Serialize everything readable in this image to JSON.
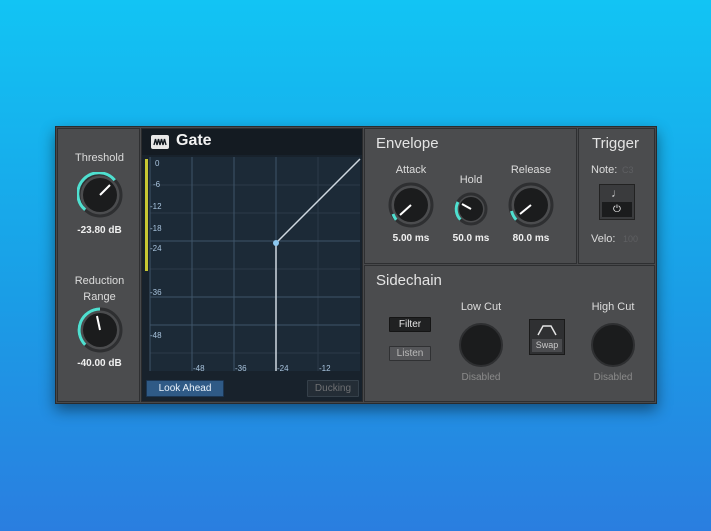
{
  "threshold": {
    "label": "Threshold",
    "value": "-23.80 dB",
    "level": 0.8
  },
  "reduction": {
    "label_line1": "Reduction",
    "label_line2": "Range",
    "value": "-40.00 dB",
    "level": 0.45
  },
  "graph": {
    "title": "Gate",
    "y_ticks": [
      "0",
      "-6",
      "-12",
      "-18",
      "-24",
      "-36",
      "-48"
    ],
    "x_ticks": [
      "-48",
      "-36",
      "-24",
      "-12"
    ],
    "look_ahead_label": "Look Ahead",
    "ducking_label": "Ducking"
  },
  "envelope": {
    "title": "Envelope",
    "attack": {
      "label": "Attack",
      "value": "5.00 ms",
      "level": 0.1
    },
    "hold": {
      "label": "Hold",
      "value": "50.0 ms",
      "level": 0.2
    },
    "release": {
      "label": "Release",
      "value": "80.0 ms",
      "level": 0.15
    }
  },
  "trigger": {
    "title": "Trigger",
    "note_label": "Note:",
    "note_value": "C3",
    "velo_label": "Velo:",
    "velo_value": "100",
    "note_icon": "music-note-icon",
    "power_icon": "power-icon"
  },
  "sidechain": {
    "title": "Sidechain",
    "filter_label": "Filter",
    "listen_label": "Listen",
    "low_cut": {
      "label": "Low Cut",
      "status": "Disabled"
    },
    "high_cut": {
      "label": "High Cut",
      "status": "Disabled"
    },
    "swap_label": "Swap",
    "swap_icon": "bandpass-icon"
  },
  "colors": {
    "accent": "#4fe0d0",
    "graph_bg": "#1c2a37",
    "graph_line": "#cfd8e0",
    "look_ahead_bg": "#2f5a86",
    "meter_yellow": "#c8c832"
  }
}
